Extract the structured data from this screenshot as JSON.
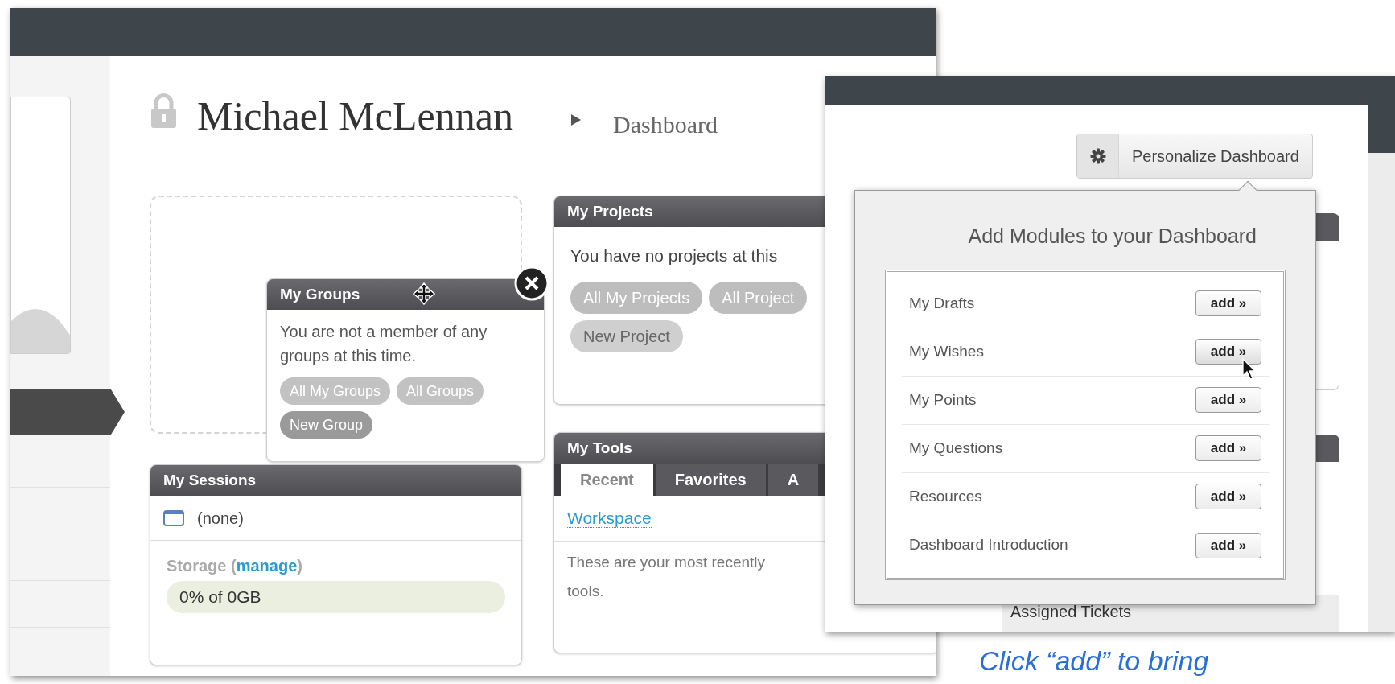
{
  "header": {
    "user": "Michael McLennan",
    "page": "Dashboard"
  },
  "my_projects": {
    "title": "My Projects",
    "message": "You have no projects at this",
    "buttons": [
      "All My Projects",
      "All Project",
      "New Project"
    ]
  },
  "my_groups": {
    "title": "My Groups",
    "message": "You are not a member of any groups at this time.",
    "buttons": [
      "All My Groups",
      "All Groups",
      "New Group"
    ]
  },
  "my_sessions": {
    "title": "My Sessions",
    "sessions": [
      "(none)"
    ],
    "storage_label": "Storage (",
    "storage_link": "manage",
    "storage_end": ")",
    "storage_usage": "0% of 0GB"
  },
  "my_tools": {
    "title": "My Tools",
    "tabs": [
      {
        "label": "Recent",
        "selected": true
      },
      {
        "label": "Favorites",
        "selected": false
      },
      {
        "label": "A",
        "selected": false
      }
    ],
    "items": [
      "Workspace"
    ],
    "note": [
      "These are your most recently",
      "tools."
    ]
  },
  "personalize": {
    "button": "Personalize Dashboard",
    "popover_title": "Add Modules to your Dashboard",
    "modules": [
      {
        "name": "My Drafts",
        "action": "add »",
        "hovered": false
      },
      {
        "name": "My Wishes",
        "action": "add »",
        "hovered": true
      },
      {
        "name": "My Points",
        "action": "add »",
        "hovered": false
      },
      {
        "name": "My Questions",
        "action": "add »",
        "hovered": false
      },
      {
        "name": "Resources",
        "action": "add »",
        "hovered": false
      },
      {
        "name": "Dashboard Introduction",
        "action": "add »",
        "hovered": false
      }
    ]
  },
  "side_module": {
    "row": "Assigned Tickets"
  },
  "caption": "Click “add” to bring"
}
